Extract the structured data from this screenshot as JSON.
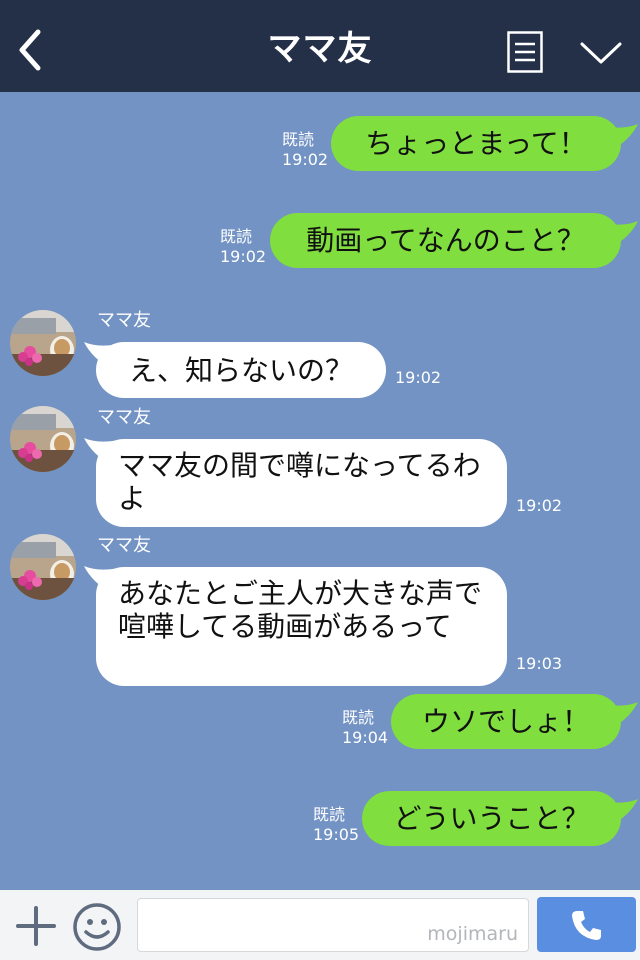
{
  "header": {
    "title": "ママ友",
    "back_icon": "back-arrow-icon",
    "menu_icon": "menu-icon",
    "expand_icon": "chevron-down-icon",
    "background": "#243048"
  },
  "chat": {
    "background": "#7293c3",
    "outgoing_color": "#80de3e",
    "incoming_color": "#ffffff",
    "messages": [
      {
        "direction": "out",
        "text": "ちょっとまって！",
        "read": "既読",
        "time": "19:02"
      },
      {
        "direction": "out",
        "text": "動画ってなんのこと？",
        "read": "既読",
        "time": "19:02"
      },
      {
        "direction": "in",
        "sender": "ママ友",
        "text": "え、知らないの？",
        "time": "19:02"
      },
      {
        "direction": "in",
        "sender": "ママ友",
        "text": "ママ友の間で噂になってるわよ",
        "time": "19:02"
      },
      {
        "direction": "in",
        "sender": "ママ友",
        "text": "あなたとご主人が大きな声で喧嘩してる動画があるって",
        "time": "19:03"
      },
      {
        "direction": "out",
        "text": "ウソでしょ！",
        "read": "既読",
        "time": "19:04"
      },
      {
        "direction": "out",
        "text": "どういうこと？",
        "read": "既読",
        "time": "19:05"
      }
    ]
  },
  "footer": {
    "plus_icon": "plus-icon",
    "emoji_icon": "smiley-icon",
    "input_value": "",
    "watermark": "mojimaru",
    "call_icon": "phone-icon",
    "call_button_color": "#5a8ee0"
  }
}
